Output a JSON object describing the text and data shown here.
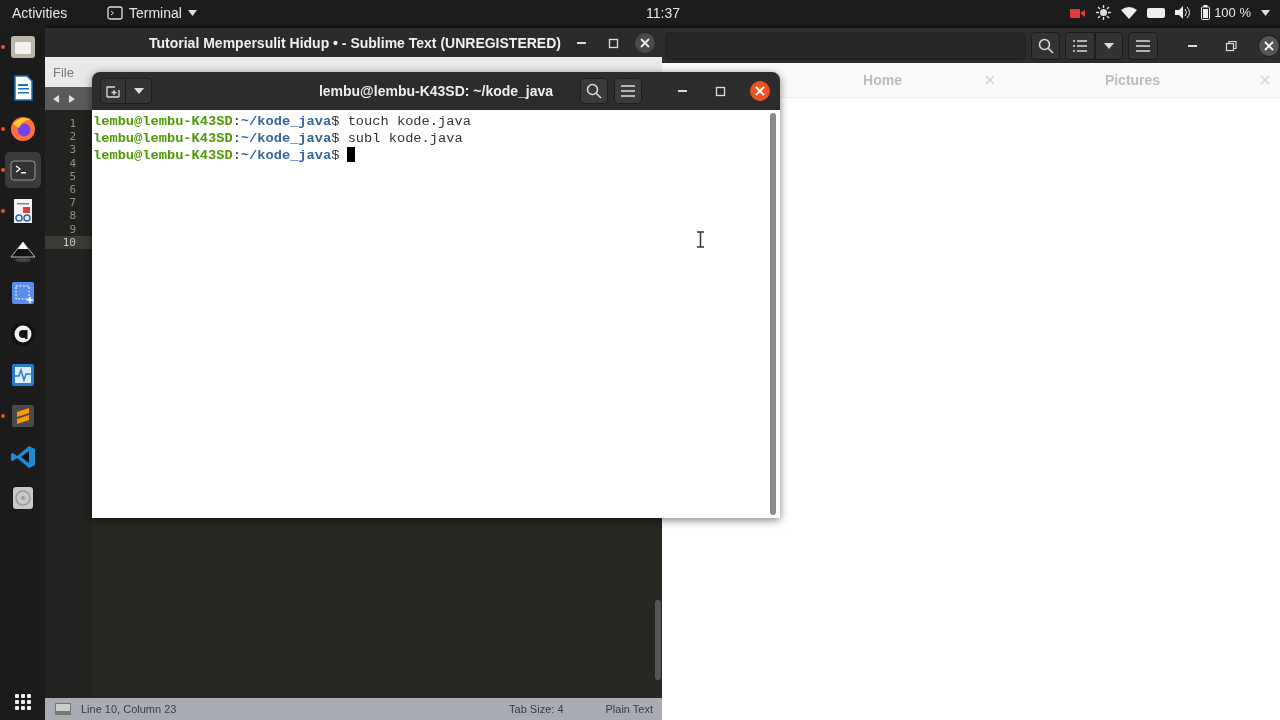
{
  "top_bar": {
    "activities": "Activities",
    "app_menu": "Terminal",
    "clock": "11:37",
    "battery_reading": "100 %"
  },
  "dock": {
    "apps": [
      {
        "kind": "files",
        "running": true,
        "selected": false
      },
      {
        "kind": "writer",
        "running": false,
        "selected": false
      },
      {
        "kind": "browser",
        "running": true,
        "selected": false
      },
      {
        "kind": "terminal",
        "running": true,
        "selected": true
      },
      {
        "kind": "viewer",
        "running": true,
        "selected": false
      },
      {
        "kind": "vector",
        "running": false,
        "selected": false
      },
      {
        "kind": "screenshot",
        "running": false,
        "selected": false
      },
      {
        "kind": "ring",
        "running": false,
        "selected": false
      },
      {
        "kind": "monitor",
        "running": false,
        "selected": false
      },
      {
        "kind": "sublime",
        "running": true,
        "selected": false
      },
      {
        "kind": "code",
        "running": false,
        "selected": false
      },
      {
        "kind": "disc",
        "running": false,
        "selected": false
      }
    ]
  },
  "editor_window": {
    "title": "Tutorial Mempersulit Hidup • - Sublime Text (UNREGISTERED)",
    "menu": [
      "File"
    ],
    "line_numbers": [
      {
        "text": "1",
        "current": false
      },
      {
        "text": "2",
        "current": false
      },
      {
        "text": "3",
        "current": false
      },
      {
        "text": "4",
        "current": false
      },
      {
        "text": "5",
        "current": false
      },
      {
        "text": "6",
        "current": false
      },
      {
        "text": "7",
        "current": false
      },
      {
        "text": "8",
        "current": false
      },
      {
        "text": "9",
        "current": false
      },
      {
        "text": "10",
        "current": true
      }
    ],
    "status_bar": {
      "position": "Line 10, Column 23",
      "tab_size": "Tab Size: 4",
      "syntax": "Plain Text"
    }
  },
  "files_window": {
    "tabs": [
      {
        "label": "Home",
        "selected": false
      },
      {
        "label": "Pictures",
        "selected": false
      }
    ]
  },
  "terminal_window": {
    "title": "lembu@lembu-K43SD: ~/kode_java",
    "lines": [
      {
        "user": "lembu@lembu-K43SD",
        "separator": ":",
        "path": "~/kode_java",
        "command": "$ touch kode.java",
        "cursor": false
      },
      {
        "user": "lembu@lembu-K43SD",
        "separator": ":",
        "path": "~/kode_java",
        "command": "$ subl kode.java",
        "cursor": false
      },
      {
        "user": "lembu@lembu-K43SD",
        "separator": ":",
        "path": "~/kode_java",
        "command": "$",
        "cursor": true
      }
    ]
  }
}
